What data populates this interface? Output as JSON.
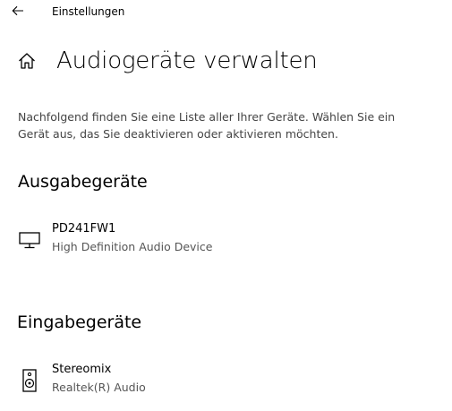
{
  "window": {
    "title": "Einstellungen",
    "back_icon": "back-arrow-icon"
  },
  "header": {
    "home_icon": "home-icon",
    "title": "Audiogeräte verwalten"
  },
  "description": "Nachfolgend finden Sie eine Liste aller Ihrer Geräte. Wählen Sie ein Gerät aus, das Sie deaktivieren oder aktivieren möchten.",
  "output_section": {
    "heading": "Ausgabegeräte",
    "devices": [
      {
        "name": "PD241FW1",
        "subtitle": "High Definition Audio Device",
        "icon": "monitor-icon"
      }
    ]
  },
  "input_section": {
    "heading": "Eingabegeräte",
    "devices": [
      {
        "name": "Stereomix",
        "subtitle": "Realtek(R) Audio",
        "icon": "speaker-icon"
      }
    ]
  },
  "colors": {
    "background": "#ffffff",
    "text": "#000000",
    "secondary_text": "#555555"
  }
}
